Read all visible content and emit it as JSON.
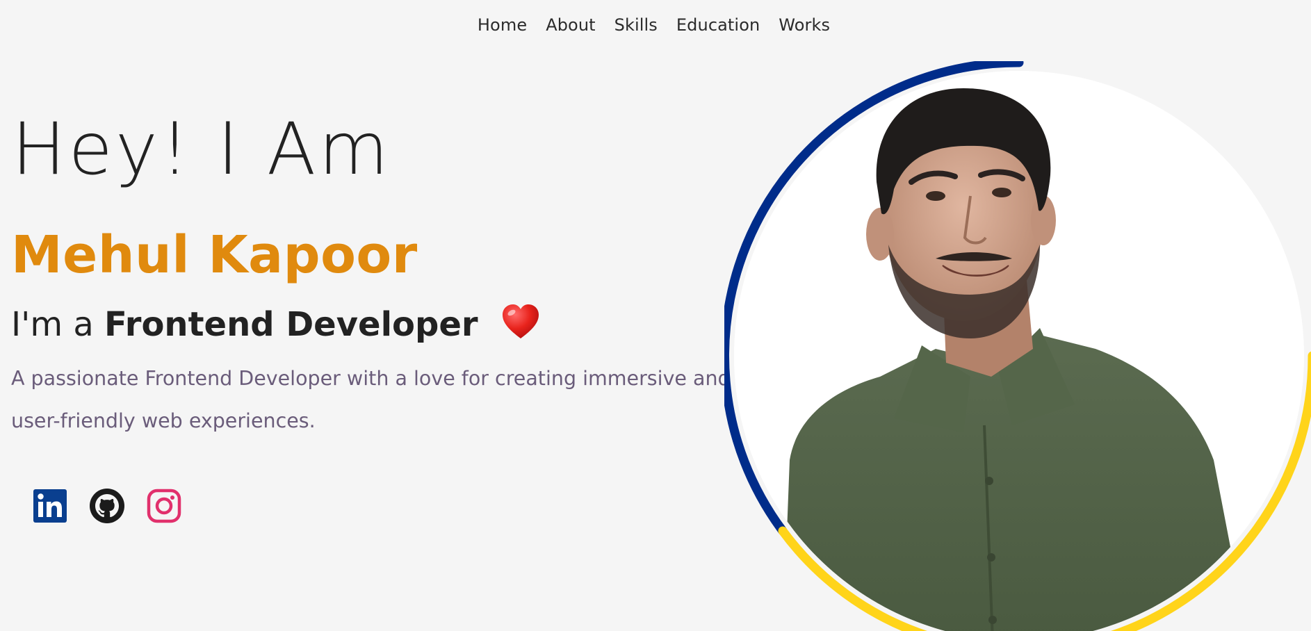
{
  "nav": {
    "items": [
      {
        "label": "Home"
      },
      {
        "label": "About"
      },
      {
        "label": "Skills"
      },
      {
        "label": "Education"
      },
      {
        "label": "Works"
      }
    ]
  },
  "hero": {
    "greeting": "Hey! I Am",
    "name": "Mehul Kapoor",
    "role_prefix": "I'm a",
    "role_title": "Frontend Developer",
    "role_emoji": "heart-icon",
    "description": "A passionate Frontend Developer with a love for creating immersive and user-friendly web experiences."
  },
  "social": [
    {
      "icon": "linkedin-icon",
      "color": "#0a4ea1"
    },
    {
      "icon": "github-icon",
      "color": "#1b1b1b"
    },
    {
      "icon": "instagram-icon",
      "color": "#e1306c"
    }
  ],
  "colors": {
    "accent": "#e08a0e",
    "ring_primary": "#002c8a",
    "ring_secondary": "#ffd41a",
    "description": "#6a5c7a",
    "background": "#f5f5f5"
  },
  "portrait": {
    "subject": "profile-photo"
  }
}
